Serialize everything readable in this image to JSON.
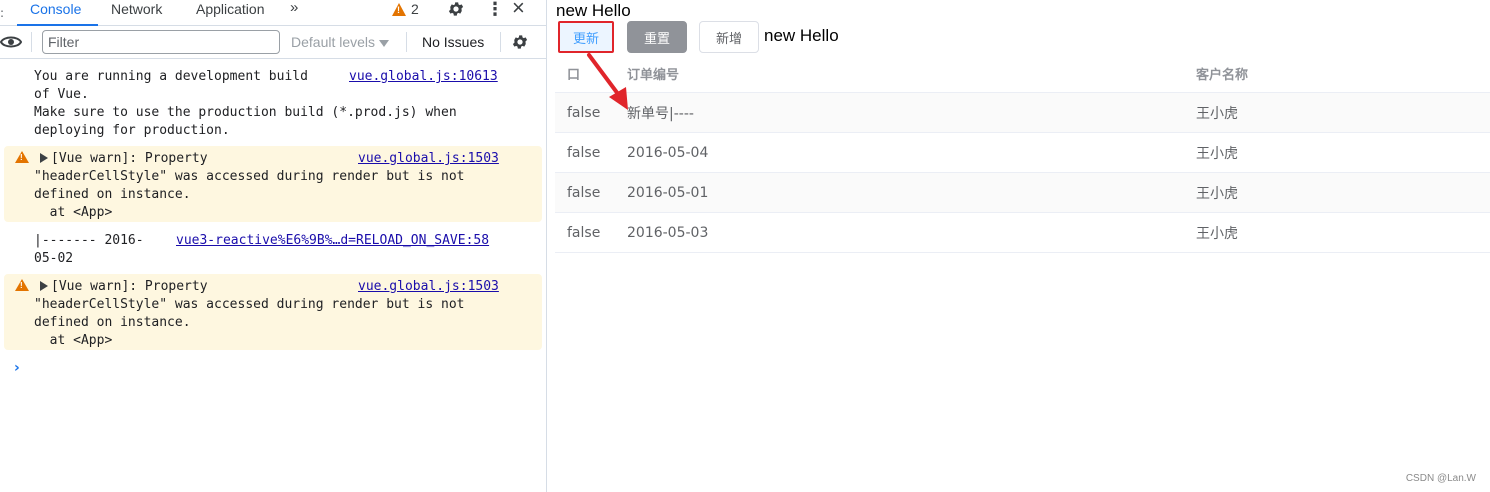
{
  "devtools": {
    "tabs": [
      {
        "label": "Console",
        "active": true
      },
      {
        "label": "Network",
        "active": false
      },
      {
        "label": "Application",
        "active": false
      }
    ],
    "more_tabs": "»",
    "warning_count": "2",
    "icons": {
      "settings": "gear-icon",
      "menu": "kebab-menu-icon",
      "close": "close-icon",
      "eye": "eye-icon",
      "warning": "warning-icon"
    },
    "toolbar": {
      "filter_placeholder": "Filter",
      "levels_label": "Default levels",
      "issues_label": "No Issues"
    },
    "messages": [
      {
        "type": "info",
        "lines": [
          "You are running a development build",
          "of Vue.",
          "Make sure to use the production build (*.prod.js) when",
          "deploying for production."
        ],
        "source": "vue.global.js:10613"
      },
      {
        "type": "warning",
        "lines": [
          "[Vue warn]: Property",
          "\"headerCellStyle\" was accessed during render but is not",
          "defined on instance.",
          "  at <App>"
        ],
        "source": "vue.global.js:1503"
      },
      {
        "type": "log",
        "lines": [
          "|------- 2016-",
          "05-02"
        ],
        "source": "vue3-reactive%E6%9B%…d=RELOAD_ON_SAVE:58"
      },
      {
        "type": "warning",
        "lines": [
          "[Vue warn]: Property",
          "\"headerCellStyle\" was accessed during render but is not",
          "defined on instance.",
          "  at <App>"
        ],
        "source": "vue.global.js:1503"
      }
    ],
    "prompt": "›"
  },
  "app": {
    "title": "new Hello",
    "buttons": {
      "update": "更新",
      "reset": "重置",
      "add": "新增"
    },
    "inline_text": "new Hello",
    "table": {
      "columns": [
        "口",
        "订单编号",
        "客户名称"
      ],
      "rows": [
        [
          "false",
          "新单号|----",
          "王小虎"
        ],
        [
          "false",
          "2016-05-04",
          "王小虎"
        ],
        [
          "false",
          "2016-05-01",
          "王小虎"
        ],
        [
          "false",
          "2016-05-03",
          "王小虎"
        ]
      ]
    },
    "annotation_color": "#e0252b",
    "watermark": "CSDN @Lan.W"
  }
}
